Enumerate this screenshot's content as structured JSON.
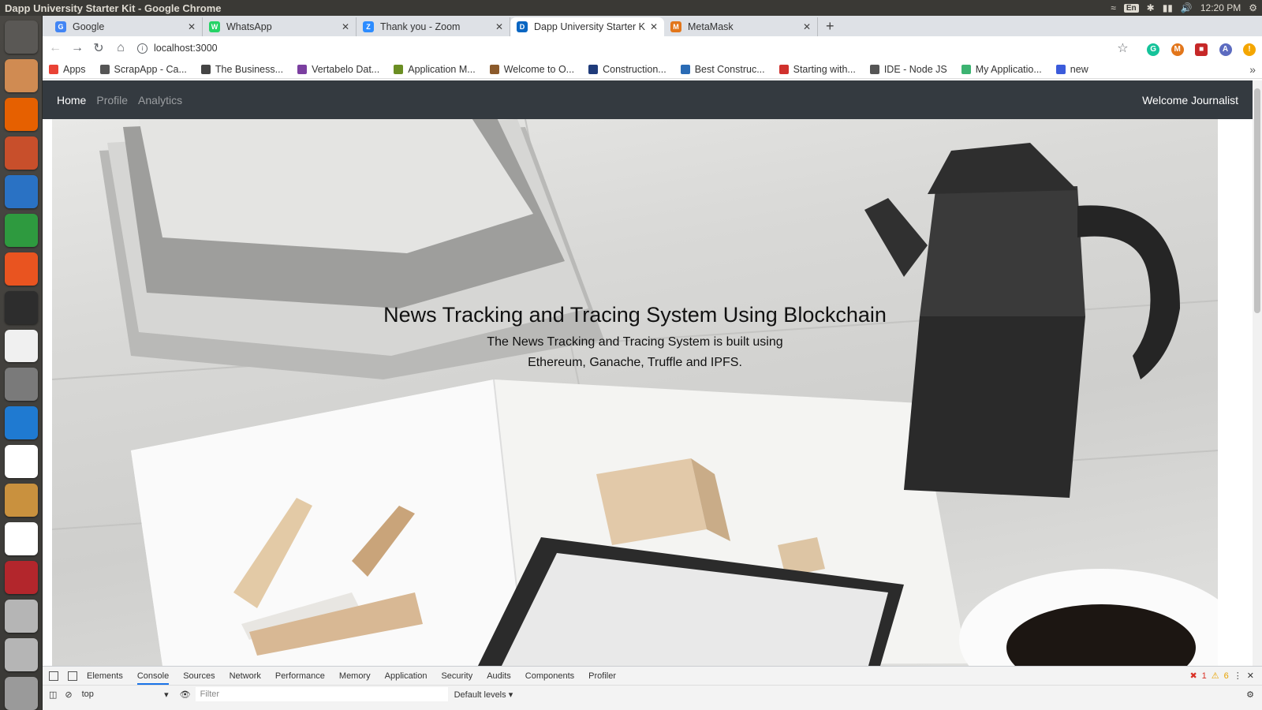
{
  "os": {
    "window_title": "Dapp University Starter Kit - Google Chrome",
    "keyboard_layout": "En",
    "clock": "12:20 PM"
  },
  "launcher": [
    {
      "name": "ubuntu-dash-icon",
      "color": "#5a5855"
    },
    {
      "name": "files-icon",
      "color": "#d08b52"
    },
    {
      "name": "firefox-icon",
      "color": "#e66000"
    },
    {
      "name": "impress-icon",
      "color": "#c84f2b"
    },
    {
      "name": "writer-icon",
      "color": "#2a72c4"
    },
    {
      "name": "calc-icon",
      "color": "#2e9a3f"
    },
    {
      "name": "software-center-icon",
      "color": "#e95420"
    },
    {
      "name": "terminal-icon",
      "color": "#2d2d2d"
    },
    {
      "name": "amazon-icon",
      "color": "#f0f0f0"
    },
    {
      "name": "settings-icon",
      "color": "#7a7a7a"
    },
    {
      "name": "vscode-icon",
      "color": "#1f7ad1"
    },
    {
      "name": "chrome-icon",
      "color": "#ffffff"
    },
    {
      "name": "package-icon",
      "color": "#c9913e"
    },
    {
      "name": "chrome-icon-2",
      "color": "#ffffff"
    },
    {
      "name": "sd-card-icon",
      "color": "#b3262c"
    },
    {
      "name": "drive-icon",
      "color": "#b5b5b5"
    },
    {
      "name": "drive-icon-2",
      "color": "#b5b5b5"
    },
    {
      "name": "trash-icon",
      "color": "#9a9a9a"
    }
  ],
  "tabs": [
    {
      "title": "Google",
      "favicon": "G",
      "color": "#4285f4",
      "active": false
    },
    {
      "title": "WhatsApp",
      "favicon": "W",
      "color": "#25d366",
      "active": false
    },
    {
      "title": "Thank you - Zoom",
      "favicon": "Z",
      "color": "#2d8cff",
      "active": false
    },
    {
      "title": "Dapp University Starter K",
      "favicon": "D",
      "color": "#0a66c2",
      "active": true
    },
    {
      "title": "MetaMask",
      "favicon": "M",
      "color": "#e2761b",
      "active": false
    }
  ],
  "omnibox": {
    "url": "localhost:3000"
  },
  "bookmarks": [
    {
      "label": "Apps",
      "color": "#e94235"
    },
    {
      "label": "ScrapApp - Ca...",
      "color": "#555555"
    },
    {
      "label": "The Business...",
      "color": "#444444"
    },
    {
      "label": "Vertabelo Dat...",
      "color": "#7b3fa0"
    },
    {
      "label": "Application M...",
      "color": "#6b8e23"
    },
    {
      "label": "Welcome to O...",
      "color": "#8b5a2b"
    },
    {
      "label": "Construction...",
      "color": "#1f3b7a"
    },
    {
      "label": "Best Construc...",
      "color": "#2a6bb5"
    },
    {
      "label": "Starting with...",
      "color": "#d0312d"
    },
    {
      "label": "IDE - Node JS",
      "color": "#555555"
    },
    {
      "label": "My Applicatio...",
      "color": "#3cb371"
    },
    {
      "label": "new",
      "color": "#3b5bdb"
    }
  ],
  "app": {
    "nav": [
      "Home",
      "Profile",
      "Analytics"
    ],
    "active_nav": "Home",
    "welcome": "Welcome Journalist",
    "hero_title": "News Tracking and Tracing System Using Blockchain",
    "hero_subtitle": "The News Tracking and Tracing System is built using Ethereum, Ganache, Truffle and IPFS."
  },
  "devtools": {
    "tabs": [
      "Elements",
      "Console",
      "Sources",
      "Network",
      "Performance",
      "Memory",
      "Application",
      "Security",
      "Audits",
      "Components",
      "Profiler"
    ],
    "active_tab": "Console",
    "errors": "1",
    "warnings": "6",
    "context": "top",
    "filter_placeholder": "Filter",
    "levels": "Default levels"
  }
}
